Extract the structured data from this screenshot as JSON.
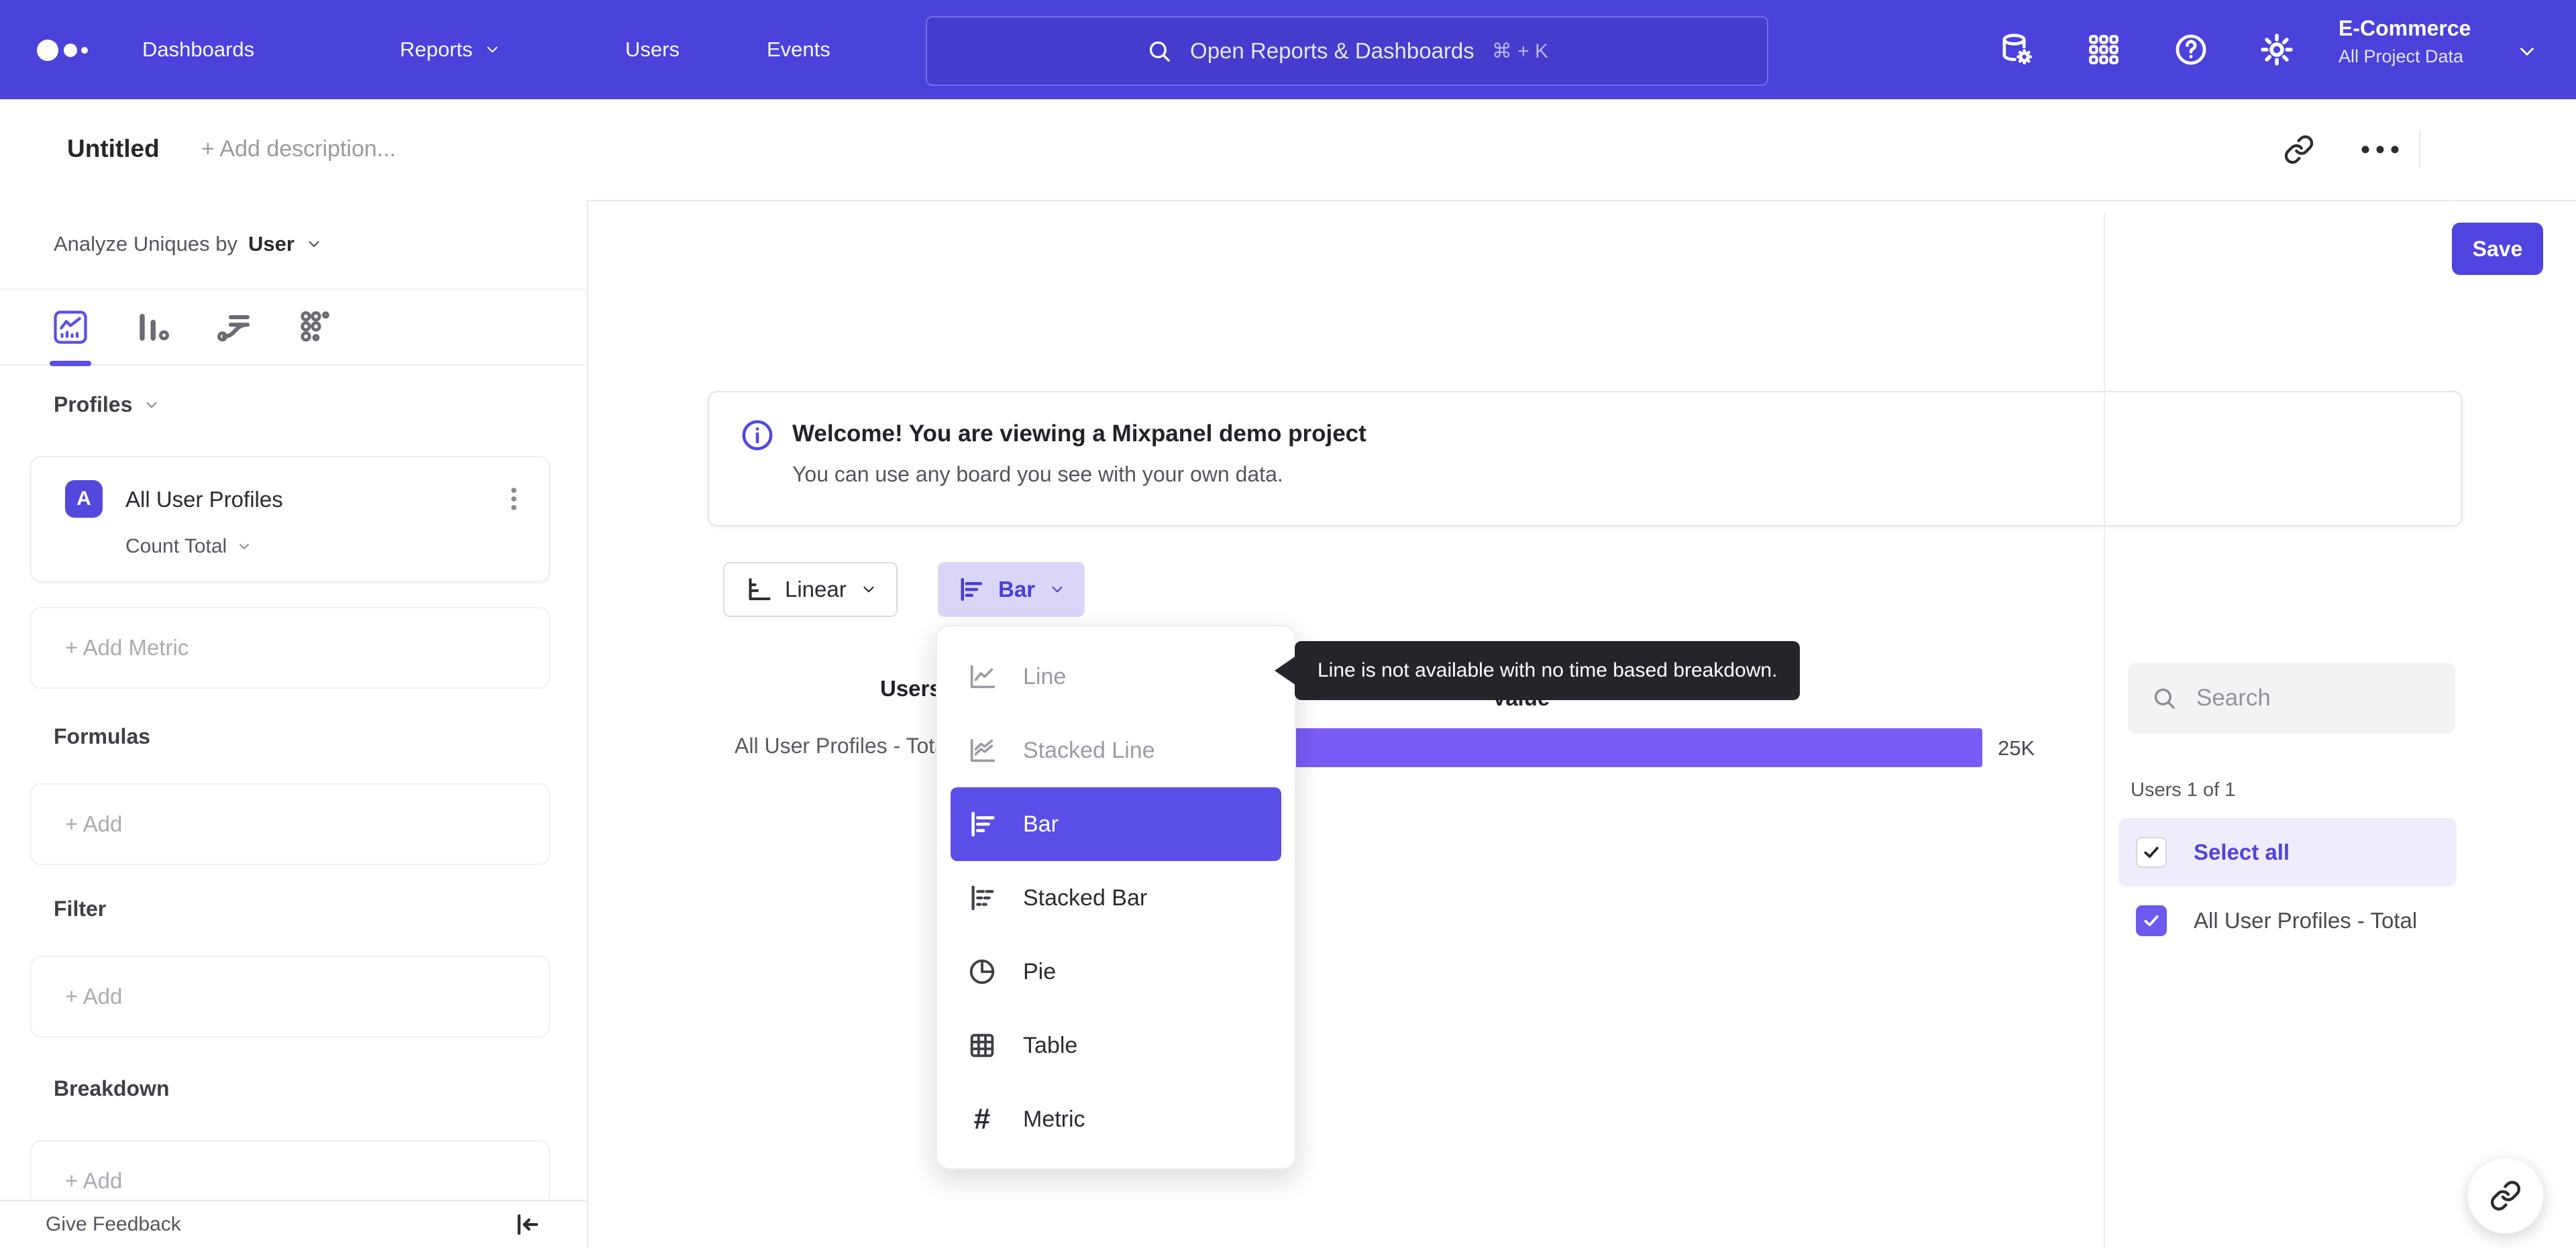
{
  "topnav": {
    "items": [
      {
        "label": "Dashboards"
      },
      {
        "label": "Reports"
      },
      {
        "label": "Users"
      },
      {
        "label": "Events"
      }
    ],
    "search_placeholder": "Open Reports & Dashboards",
    "search_shortcut": "⌘ + K",
    "project_name": "E-Commerce",
    "project_scope": "All Project Data"
  },
  "header": {
    "title": "Untitled",
    "description_placeholder": "+ Add description...",
    "save_label": "Save"
  },
  "sidebar": {
    "analyze_prefix": "Analyze Uniques by",
    "analyze_value": "User",
    "profiles_heading": "Profiles",
    "metric_card": {
      "badge": "A",
      "name": "All User Profiles",
      "aggregation": "Count Total"
    },
    "add_metric_label": "+ Add Metric",
    "formulas_heading": "Formulas",
    "formulas_add_label": "+ Add",
    "filter_heading": "Filter",
    "filter_add_label": "+ Add",
    "breakdown_heading": "Breakdown",
    "breakdown_add_label": "+ Add",
    "give_feedback_label": "Give Feedback"
  },
  "banner": {
    "title": "Welcome! You are viewing a Mixpanel demo project",
    "subtitle": "You can use any board you see with your own data."
  },
  "controls": {
    "scale_label": "Linear",
    "chart_type_label": "Bar"
  },
  "chart_type_menu": {
    "items": [
      {
        "label": "Line",
        "state": "disabled"
      },
      {
        "label": "Stacked Line",
        "state": "disabled"
      },
      {
        "label": "Bar",
        "state": "selected"
      },
      {
        "label": "Stacked Bar",
        "state": "normal"
      },
      {
        "label": "Pie",
        "state": "normal"
      },
      {
        "label": "Table",
        "state": "normal"
      },
      {
        "label": "Metric",
        "state": "normal"
      }
    ]
  },
  "tooltip": {
    "text": "Line is not available with no time based breakdown."
  },
  "chart_data": {
    "type": "bar",
    "orientation": "horizontal",
    "column_headers": [
      "Users",
      "Value"
    ],
    "categories": [
      "All User Profiles - Total"
    ],
    "values": [
      25000
    ],
    "value_labels": [
      "25K"
    ],
    "bar_color": "#7B5BF5",
    "xlim": [
      0,
      25000
    ],
    "grid": false,
    "legend": false
  },
  "right_panel": {
    "search_placeholder": "Search",
    "count_label": "Users 1 of 1",
    "select_all_label": "Select all",
    "select_all_checked": true,
    "items": [
      {
        "label": "All User Profiles - Total",
        "checked": true
      }
    ]
  },
  "colors": {
    "nav_bg": "#4A42DB",
    "accent": "#5B4EE9",
    "bar": "#7B5BF5",
    "tooltip_bg": "#26242B",
    "selected_row_bg": "#EFECFB"
  }
}
